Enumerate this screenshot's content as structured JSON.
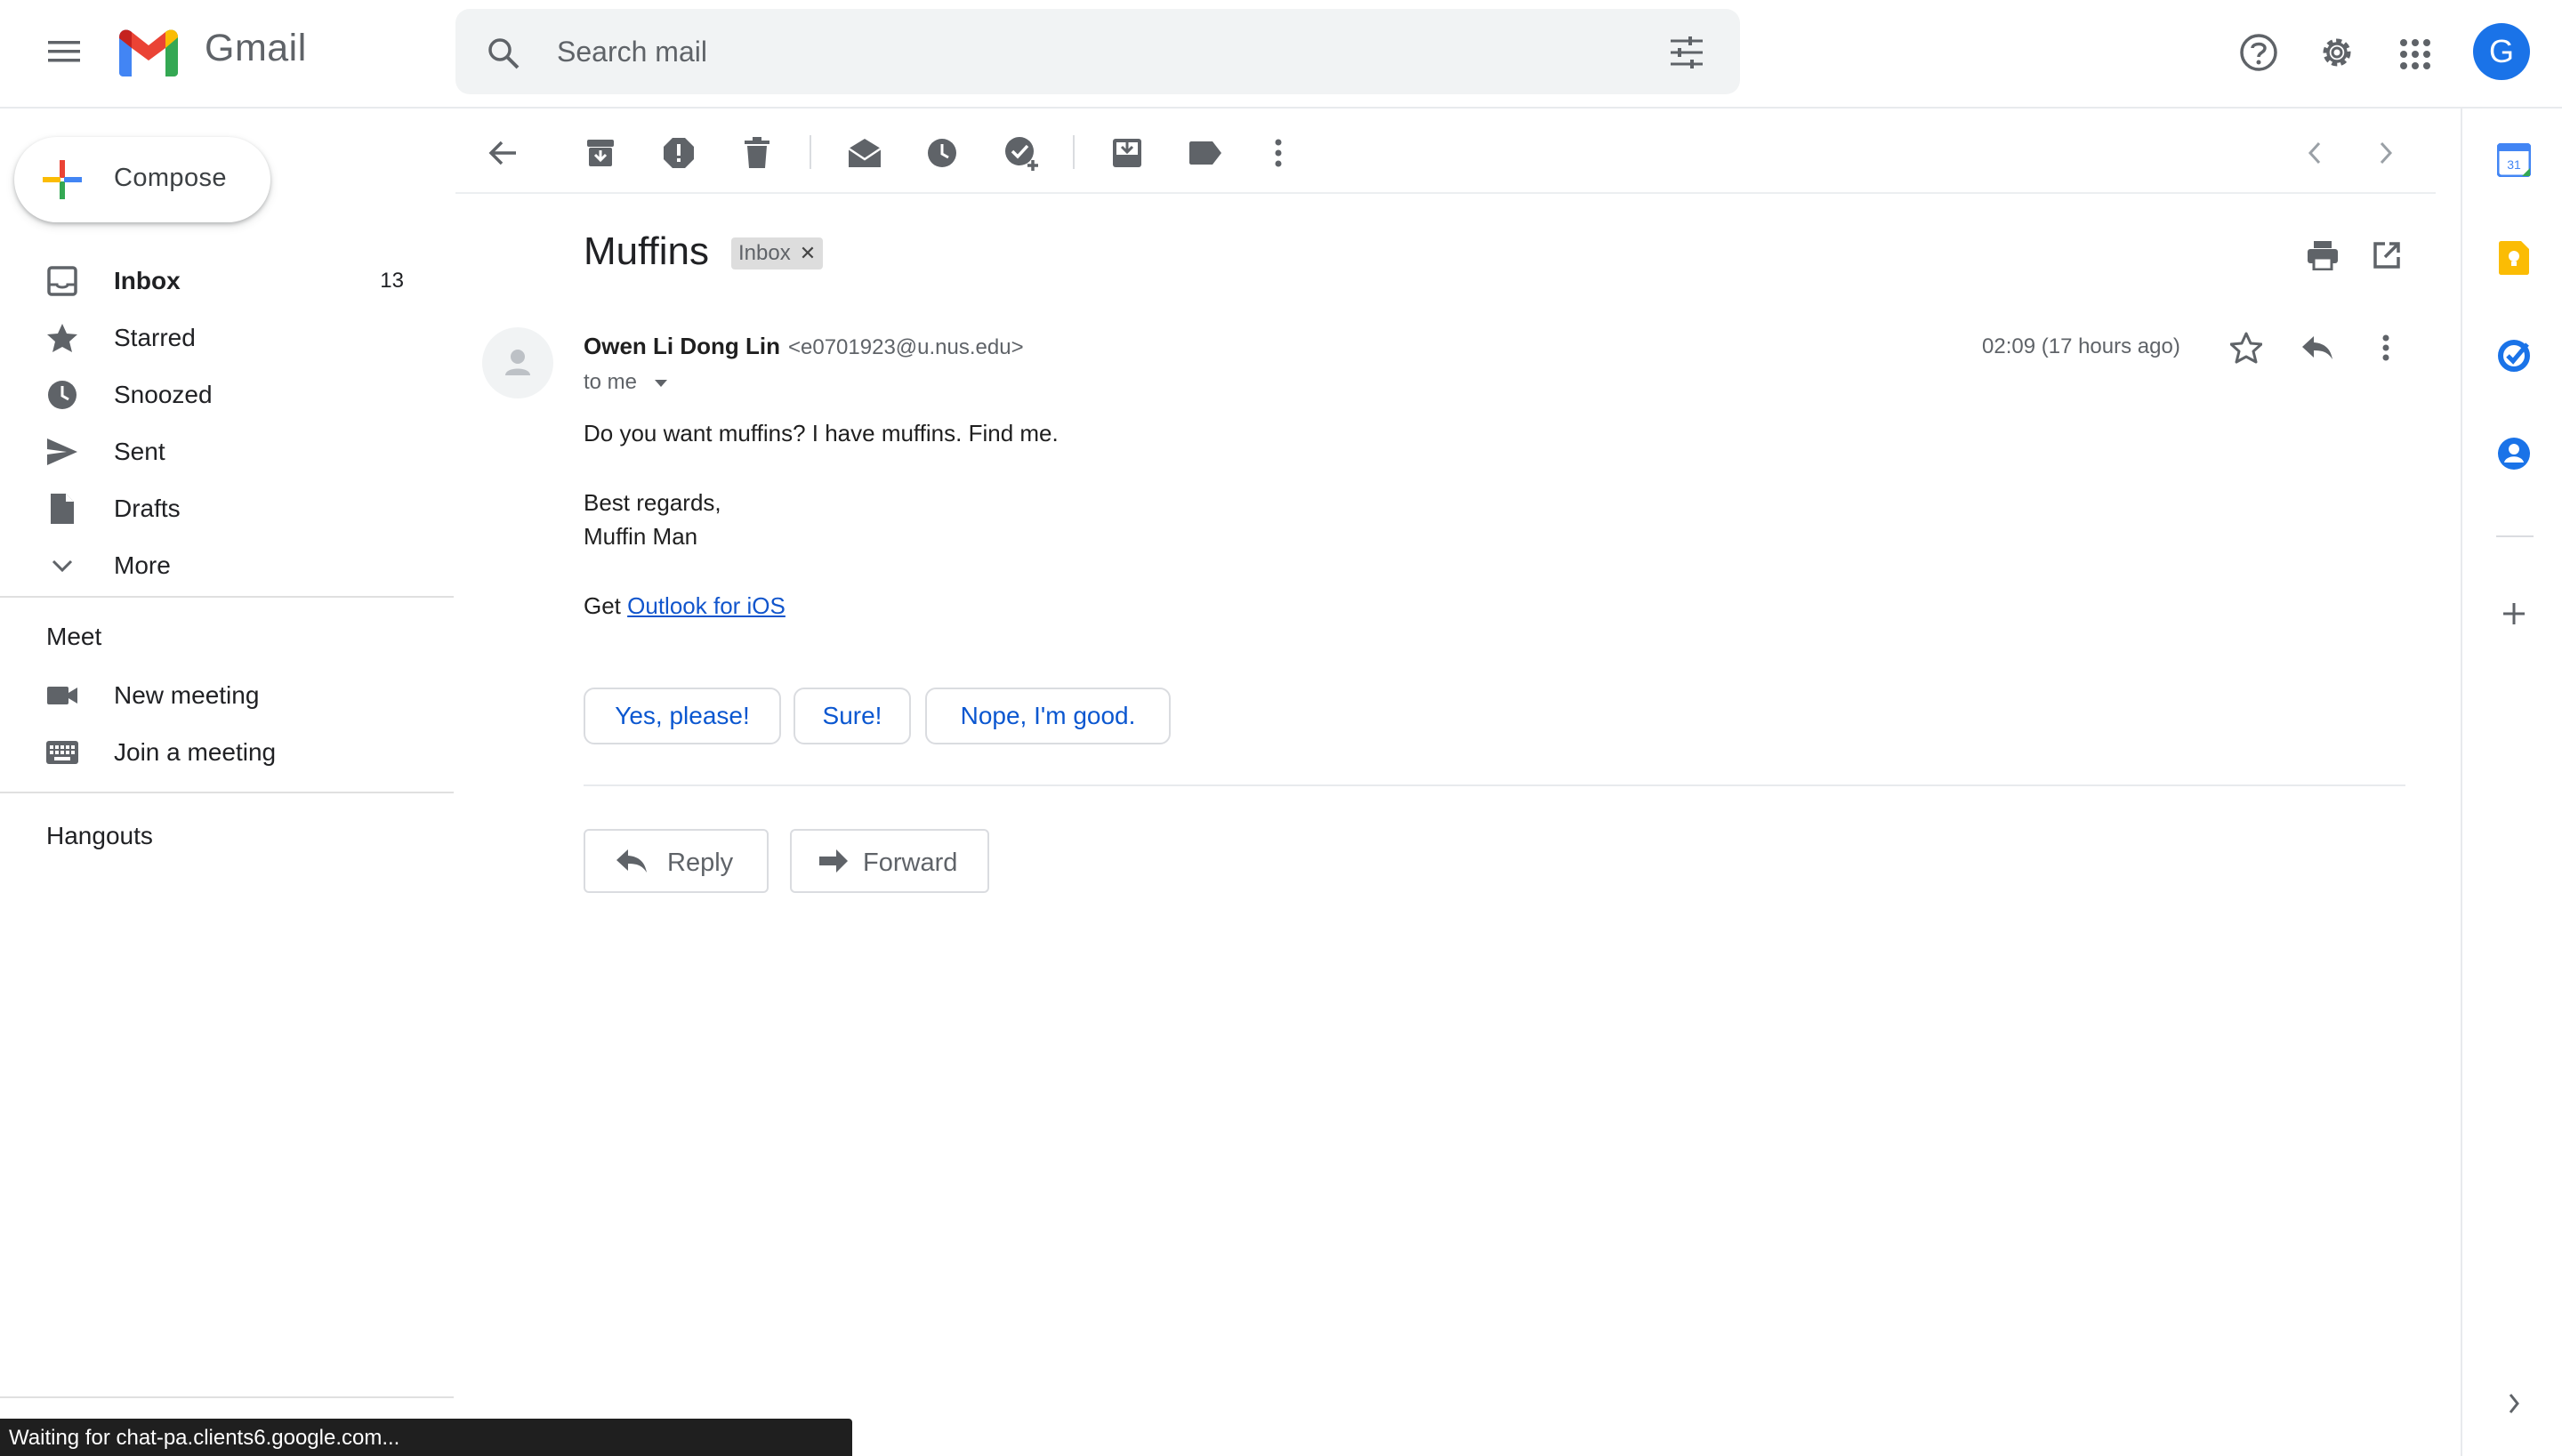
{
  "app": {
    "logo_text": "Gmail",
    "search_placeholder": "Search mail",
    "avatar_letter": "G"
  },
  "sidebar": {
    "compose_label": "Compose",
    "items": [
      {
        "label": "Inbox",
        "count": "13",
        "icon": "inbox-icon"
      },
      {
        "label": "Starred",
        "icon": "star-icon"
      },
      {
        "label": "Snoozed",
        "icon": "clock-icon"
      },
      {
        "label": "Sent",
        "icon": "send-icon"
      },
      {
        "label": "Drafts",
        "icon": "draft-icon"
      },
      {
        "label": "More",
        "icon": "chevron-down-icon"
      }
    ],
    "meet_title": "Meet",
    "meet_items": [
      {
        "label": "New meeting",
        "icon": "video-icon"
      },
      {
        "label": "Join a meeting",
        "icon": "keyboard-icon"
      }
    ],
    "hangouts_title": "Hangouts"
  },
  "message": {
    "subject": "Muffins",
    "label_chip": "Inbox",
    "sender_name": "Owen Li Dong Lin",
    "sender_email": "<e0701923@u.nus.edu>",
    "to": "to me",
    "timestamp": "02:09 (17 hours ago)",
    "body": {
      "line1": "Do you want muffins?  I have muffins. Find me.",
      "line2": "Best regards,",
      "line3": "Muffin Man",
      "line4_prefix": "Get ",
      "line4_link": "Outlook for iOS"
    },
    "smart_replies": [
      "Yes, please!",
      "Sure!",
      "Nope, I'm good."
    ],
    "reply_label": "Reply",
    "forward_label": "Forward"
  },
  "status_bar": {
    "text": "Waiting for chat-pa.clients6.google.com..."
  },
  "colors": {
    "accent_blue": "#1a73e8",
    "link": "#1155cc",
    "icon_gray": "#5f6368"
  }
}
